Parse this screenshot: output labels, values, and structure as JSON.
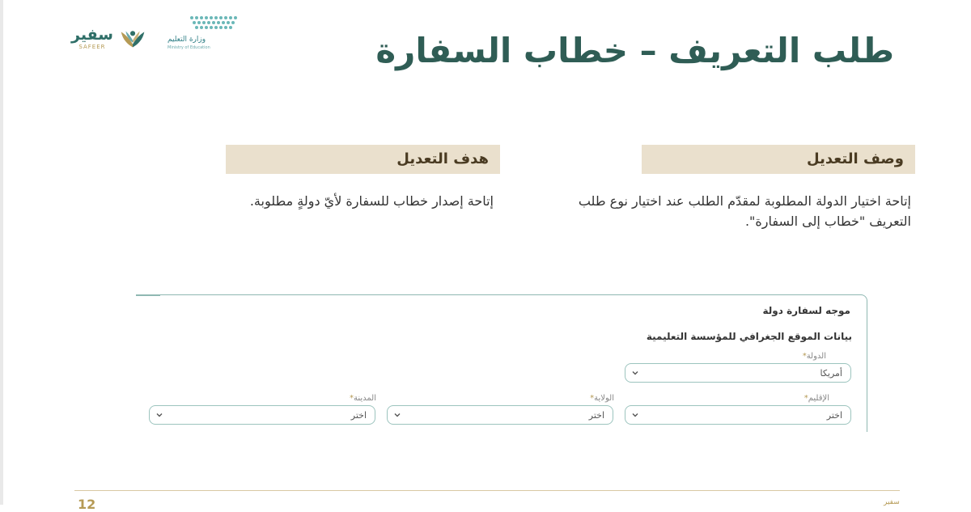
{
  "header": {
    "title": "طلب التعريف – خطاب السفارة",
    "brand_safeer": {
      "ar": "سفير",
      "en": "SAFEER"
    },
    "brand_moe": {
      "ar": "وزارة التعليم",
      "en": "Ministry of Education"
    }
  },
  "sections": {
    "description": {
      "heading": "وصف التعديل",
      "text": "إتاحة اختيار الدولة المطلوبة لمقدّم الطلب عند اختيار نوع طلب التعريف \"خطاب إلى السفارة\"."
    },
    "goal": {
      "heading": "هدف التعديل",
      "text": "إتاحة إصدار خطاب للسفارة لأيّ دولةٍ مطلوبة."
    }
  },
  "form": {
    "heading": "موجه لسفارة دولة",
    "subheading": "بيانات الموقع الجغرافي للمؤسسة التعليمية",
    "country": {
      "label": "الدولة",
      "value": "أمريكا"
    },
    "region": {
      "label": "الإقليم",
      "value": "اختر"
    },
    "state": {
      "label": "الولاية",
      "value": "اختر"
    },
    "city": {
      "label": "المدينة",
      "value": "اختر"
    },
    "required_mark": "*"
  },
  "footer": {
    "page_number": "12",
    "brand": "سفير"
  },
  "colors": {
    "title": "#2f5d55",
    "band": "#eae0cd",
    "accent_gold": "#b59a55",
    "border_teal": "#8fb8b2"
  }
}
